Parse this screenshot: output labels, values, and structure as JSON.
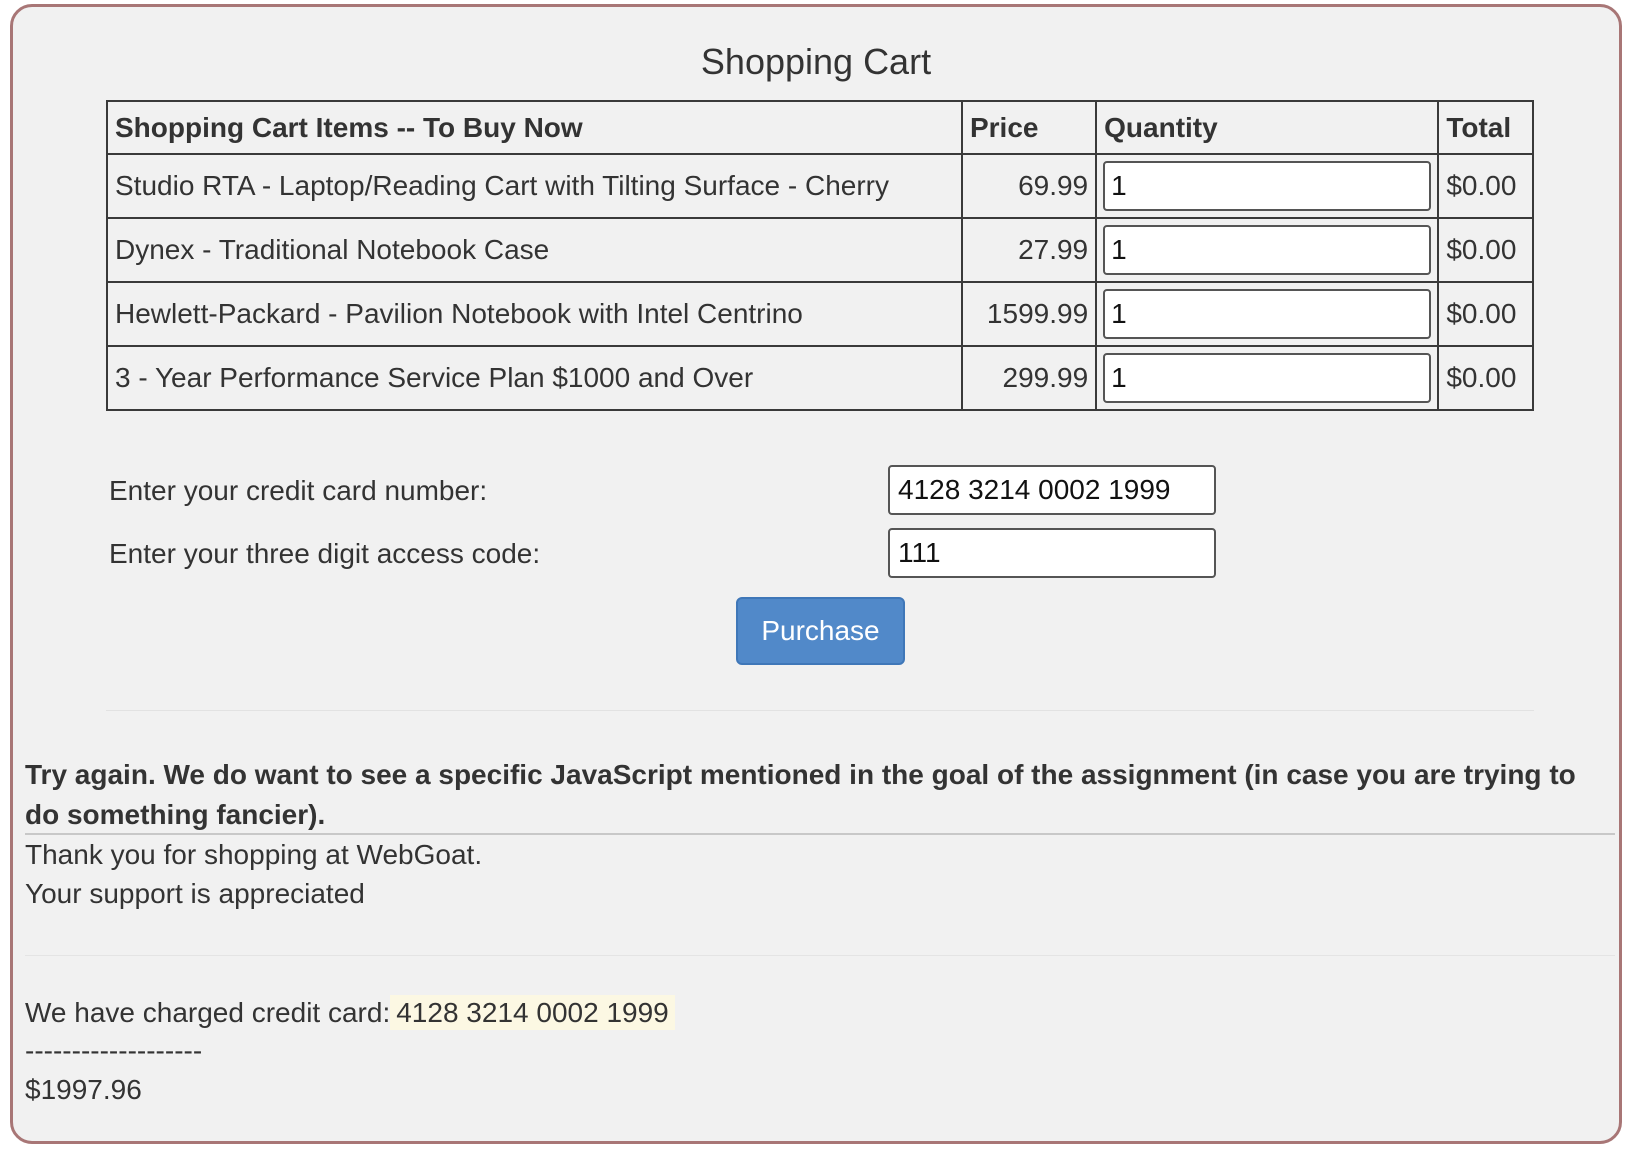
{
  "page": {
    "title": "Shopping Cart"
  },
  "cart": {
    "headers": {
      "item": "Shopping Cart Items -- To Buy Now",
      "price": "Price",
      "quantity": "Quantity",
      "total": "Total"
    },
    "rows": [
      {
        "item": "Studio RTA - Laptop/Reading Cart with Tilting Surface - Cherry",
        "price": "69.99",
        "quantity": "1",
        "total": "$0.00"
      },
      {
        "item": "Dynex - Traditional Notebook Case",
        "price": "27.99",
        "quantity": "1",
        "total": "$0.00"
      },
      {
        "item": "Hewlett-Packard - Pavilion Notebook with Intel Centrino",
        "price": "1599.99",
        "quantity": "1",
        "total": "$0.00"
      },
      {
        "item": "3 - Year Performance Service Plan $1000 and Over",
        "price": "299.99",
        "quantity": "1",
        "total": "$0.00"
      }
    ]
  },
  "payment": {
    "card_label": "Enter your credit card number:",
    "card_value": "4128 3214 0002 1999",
    "code_label": "Enter your three digit access code:",
    "code_value": "111",
    "purchase_label": "Purchase"
  },
  "feedback": {
    "message": "Try again. We do want to see a specific JavaScript mentioned in the goal of the assignment (in case you are trying to do something fancier)."
  },
  "output": {
    "thanks_line1": "Thank you for shopping at WebGoat.",
    "thanks_line2": "Your support is appreciated",
    "charged_prefix": "We have charged credit card:",
    "charged_card": "4128 3214 0002 1999",
    "separator": "-------------------",
    "amount": "$1997.96"
  },
  "colors": {
    "frame_border": "#a87676",
    "panel_background": "#f1f1f1",
    "button": "#5189c9",
    "highlight": "#fcf8e3"
  }
}
